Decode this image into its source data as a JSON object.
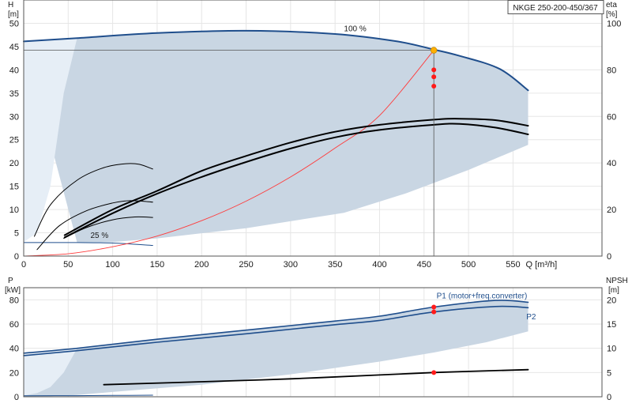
{
  "model": "NKGE 250-200-450/367",
  "colors": {
    "envelope": "#c9d6e3",
    "envelope_light": "#e6eef6",
    "blue_curve": "#1f4e8c",
    "system_curve": "#ff3b3b",
    "dot_red": "#ff1a1a",
    "dot_orange": "#ffb000",
    "black": "#000000",
    "grid": "#e6e6e6",
    "axis": "#555555"
  },
  "chart_data": [
    {
      "type": "line",
      "id": "head-efficiency",
      "xlabel": "Q",
      "xunit": "[m³/h]",
      "ylabel": "H",
      "yunit": "[m]",
      "y2label": "eta",
      "y2unit": "[%]",
      "xlim": [
        0,
        650
      ],
      "ylim": [
        0,
        55
      ],
      "y2lim": [
        0,
        110
      ],
      "xticks": [
        0,
        50,
        100,
        150,
        200,
        250,
        300,
        350,
        400,
        450,
        500,
        550
      ],
      "yticks": [
        0,
        5,
        10,
        15,
        20,
        25,
        30,
        35,
        40,
        45,
        50
      ],
      "y2ticks": [
        0,
        20,
        40,
        60,
        80,
        100
      ],
      "annotations": [
        {
          "text": "100 %",
          "x": 360,
          "y": 48.3
        },
        {
          "text": "25 %",
          "x": 75,
          "y": 3.9
        }
      ],
      "envelope": {
        "upper": [
          [
            0,
            46.1
          ],
          [
            60,
            46.8
          ],
          [
            150,
            47.9
          ],
          [
            250,
            48.4
          ],
          [
            350,
            47.7
          ],
          [
            420,
            46.1
          ],
          [
            460,
            44.4
          ],
          [
            490,
            43
          ],
          [
            535,
            40.2
          ],
          [
            567,
            35.6
          ]
        ],
        "lower": [
          [
            567,
            23.9
          ],
          [
            500,
            18.5
          ],
          [
            430,
            13.5
          ],
          [
            360,
            9.3
          ],
          [
            250,
            6
          ],
          [
            150,
            3.8
          ],
          [
            100,
            3
          ],
          [
            60,
            2.9
          ]
        ],
        "light_left": [
          [
            0,
            46.1
          ],
          [
            60,
            46.8
          ],
          [
            45,
            35
          ],
          [
            30,
            15
          ],
          [
            15,
            5
          ],
          [
            0,
            3
          ]
        ]
      },
      "series": [
        {
          "name": "100 %",
          "role": "head",
          "color": "#1f4e8c",
          "axis": "y",
          "points": [
            [
              0,
              46.1
            ],
            [
              60,
              46.8
            ],
            [
              150,
              47.9
            ],
            [
              250,
              48.4
            ],
            [
              350,
              47.7
            ],
            [
              420,
              46.1
            ],
            [
              460,
              44.4
            ],
            [
              490,
              43
            ],
            [
              535,
              40.2
            ],
            [
              567,
              35.6
            ]
          ]
        },
        {
          "name": "25 %",
          "role": "head",
          "color": "#1f4e8c",
          "axis": "y",
          "points": [
            [
              0,
              2.9
            ],
            [
              60,
              2.9
            ],
            [
              100,
              2.8
            ],
            [
              145,
              2.3
            ]
          ]
        },
        {
          "name": "system curve",
          "role": "system",
          "color": "#ff3b3b",
          "axis": "y",
          "points": [
            [
              0,
              0
            ],
            [
              50,
              0.5
            ],
            [
              100,
              2
            ],
            [
              150,
              4.3
            ],
            [
              200,
              7.6
            ],
            [
              250,
              11.8
            ],
            [
              300,
              17
            ],
            [
              350,
              23.2
            ],
            [
              400,
              30.2
            ],
            [
              461,
              44.2
            ]
          ]
        },
        {
          "name": "eta upper",
          "role": "eta",
          "color": "#000000",
          "axis": "y2",
          "points": [
            [
              46,
              9
            ],
            [
              100,
              20
            ],
            [
              150,
              28
            ],
            [
              200,
              36.6
            ],
            [
              250,
              43
            ],
            [
              300,
              48.8
            ],
            [
              350,
              53.4
            ],
            [
              400,
              56.4
            ],
            [
              461,
              58.6
            ],
            [
              490,
              59
            ],
            [
              530,
              58.4
            ],
            [
              567,
              56
            ]
          ]
        },
        {
          "name": "eta lower",
          "role": "eta",
          "color": "#000000",
          "axis": "y2",
          "points": [
            [
              46,
              8
            ],
            [
              100,
              18.4
            ],
            [
              150,
              26.8
            ],
            [
              200,
              34
            ],
            [
              250,
              40.4
            ],
            [
              300,
              46.2
            ],
            [
              350,
              51
            ],
            [
              400,
              54.2
            ],
            [
              461,
              56.4
            ],
            [
              490,
              56.8
            ],
            [
              530,
              55.2
            ],
            [
              567,
              52.3
            ]
          ]
        },
        {
          "name": "eta small 1",
          "role": "eta",
          "color": "#000000",
          "axis": "y2",
          "points": [
            [
              12,
              8.5
            ],
            [
              30,
              22
            ],
            [
              60,
              32.6
            ],
            [
              90,
              38
            ],
            [
              115,
              39.7
            ],
            [
              130,
              39.4
            ],
            [
              145,
              37.4
            ]
          ]
        },
        {
          "name": "eta small 2",
          "role": "eta",
          "color": "#000000",
          "axis": "y2",
          "points": [
            [
              15,
              2.8
            ],
            [
              40,
              13
            ],
            [
              70,
              19.4
            ],
            [
              100,
              22.8
            ],
            [
              120,
              23.8
            ],
            [
              145,
              23.2
            ]
          ]
        },
        {
          "name": "eta small 3",
          "role": "eta",
          "color": "#000000",
          "axis": "y2",
          "points": [
            [
              45,
              7.6
            ],
            [
              70,
              12.2
            ],
            [
              100,
              15.6
            ],
            [
              125,
              16.8
            ],
            [
              145,
              16.6
            ]
          ]
        }
      ],
      "operating_points": [
        {
          "x": 461,
          "y": 44.2,
          "axis": "y",
          "color": "#ffb000"
        },
        {
          "x": 461,
          "y": 80,
          "axis": "y2",
          "color": "#ff1a1a"
        },
        {
          "x": 461,
          "y": 77,
          "axis": "y2",
          "color": "#ff1a1a"
        },
        {
          "x": 461,
          "y": 73,
          "axis": "y2",
          "color": "#ff1a1a"
        }
      ]
    },
    {
      "type": "line",
      "id": "power-npsh",
      "xlabel": "Q",
      "xunit": "[m³/h]",
      "ylabel": "P",
      "yunit": "[kW]",
      "y2label": "NPSH",
      "y2unit": "[m]",
      "xlim": [
        0,
        650
      ],
      "ylim": [
        0,
        90
      ],
      "y2lim": [
        0,
        22.5
      ],
      "yticks": [
        0,
        20,
        40,
        60,
        80
      ],
      "y2ticks": [
        0,
        5,
        10,
        15,
        20
      ],
      "envelope": {
        "upper": [
          [
            0,
            36
          ],
          [
            60,
            40
          ],
          [
            150,
            47.5
          ],
          [
            250,
            55
          ],
          [
            350,
            62.5
          ],
          [
            400,
            66.5
          ],
          [
            461,
            74
          ],
          [
            530,
            79.5
          ],
          [
            567,
            78
          ]
        ],
        "lower": [
          [
            567,
            54
          ],
          [
            520,
            45
          ],
          [
            461,
            36.5
          ],
          [
            400,
            29
          ],
          [
            300,
            18.5
          ],
          [
            200,
            10
          ],
          [
            100,
            4
          ],
          [
            60,
            1.5
          ],
          [
            30,
            0.5
          ],
          [
            0,
            0.3
          ]
        ],
        "light_left": [
          [
            0,
            36
          ],
          [
            60,
            40
          ],
          [
            45,
            20
          ],
          [
            30,
            8
          ],
          [
            15,
            3
          ],
          [
            0,
            1
          ]
        ]
      },
      "series": [
        {
          "name": "P1 (motor+freq.converter)",
          "role": "power",
          "color": "#1f4e8c",
          "axis": "y",
          "points": [
            [
              0,
              36
            ],
            [
              60,
              40
            ],
            [
              150,
              47.5
            ],
            [
              250,
              55
            ],
            [
              350,
              62.5
            ],
            [
              400,
              66.5
            ],
            [
              461,
              74
            ],
            [
              530,
              79.5
            ],
            [
              567,
              78
            ]
          ]
        },
        {
          "name": "P2",
          "role": "power",
          "color": "#1f4e8c",
          "axis": "y",
          "points": [
            [
              0,
              34
            ],
            [
              60,
              38
            ],
            [
              150,
              45
            ],
            [
              250,
              52
            ],
            [
              350,
              59.5
            ],
            [
              400,
              63
            ],
            [
              461,
              70
            ],
            [
              530,
              74.5
            ],
            [
              567,
              73.5
            ]
          ]
        },
        {
          "name": "P1 25 %",
          "role": "power",
          "color": "#1f4e8c",
          "axis": "y",
          "points": [
            [
              0,
              0.8
            ],
            [
              60,
              0.9
            ],
            [
              100,
              1.1
            ],
            [
              145,
              1.3
            ]
          ]
        },
        {
          "name": "NPSH",
          "role": "npsh",
          "color": "#000000",
          "axis": "y2",
          "points": [
            [
              90,
              2.5
            ],
            [
              200,
              3.1
            ],
            [
              300,
              3.7
            ],
            [
              400,
              4.5
            ],
            [
              461,
              5
            ],
            [
              530,
              5.4
            ],
            [
              567,
              5.6
            ]
          ]
        }
      ],
      "operating_points": [
        {
          "x": 461,
          "y": 74,
          "axis": "y",
          "color": "#ff1a1a"
        },
        {
          "x": 461,
          "y": 70,
          "axis": "y",
          "color": "#ff1a1a"
        },
        {
          "x": 461,
          "y": 5,
          "axis": "y2",
          "color": "#ff1a1a"
        }
      ]
    }
  ]
}
